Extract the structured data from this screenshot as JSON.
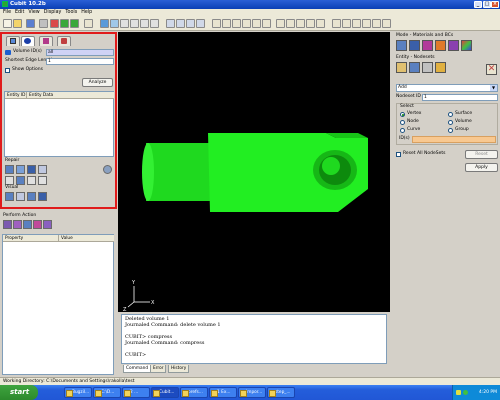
{
  "window": {
    "title": "Cubit 10.2b"
  },
  "menu": [
    "File",
    "Edit",
    "View",
    "Display",
    "Tools",
    "Help"
  ],
  "left_panel": {
    "volume_label": "Volume ID(s)",
    "volume_value": "all",
    "shortest_edge_label": "Shortest Edge Length",
    "shortest_edge_value": "1",
    "show_options_label": "Show Options",
    "analyze_button": "Analyze",
    "grid_columns": [
      "Entity ID",
      "Entity Data"
    ],
    "repair_label": "Repair",
    "visual_label": "Visual"
  },
  "lower_left": {
    "perform_action_label": "Perform Action",
    "property_columns": [
      "Property",
      "Value"
    ]
  },
  "console": {
    "lines": [
      "Deleted volume 1",
      "Journaled Command: delete volume 1",
      "",
      "CUBIT> compress",
      "Journaled Command: compress",
      "",
      "CUBIT>"
    ],
    "tabs": [
      "Command",
      "Error",
      "History"
    ]
  },
  "right_panel": {
    "mode_label": "Mode - Materials and BCs",
    "entity_label": "Entity - Nodesets",
    "action_select": "Add",
    "nodeset_label": "Nodeset ID",
    "nodeset_value": "1",
    "select_label": "Select",
    "options": [
      {
        "label": "Vertex",
        "checked": true
      },
      {
        "label": "Surface",
        "checked": false
      },
      {
        "label": "Node",
        "checked": false
      },
      {
        "label": "Volume",
        "checked": false
      },
      {
        "label": "Curve",
        "checked": false
      },
      {
        "label": "Group",
        "checked": false
      }
    ],
    "ids_label": "ID(s)",
    "reset_label": "Reset All NodeSets",
    "reset_button": "Reset",
    "apply_button": "Apply"
  },
  "viewport": {
    "axis_labels": [
      "Y",
      "Z",
      "X"
    ],
    "background": "#000000",
    "model_color": "#22ee22"
  },
  "status": {
    "working_dir": "Working Directory: C:\\Documents and Settings\\rakolla\\test"
  },
  "taskbar": {
    "start_label": "start",
    "tasks": [
      "Bugzil...",
      "C:\\D...",
      "2 ...",
      "Cubit...",
      "prefs...",
      "1 Ex...",
      "Impor...",
      "step_..."
    ],
    "clock": "4:20 PM"
  }
}
